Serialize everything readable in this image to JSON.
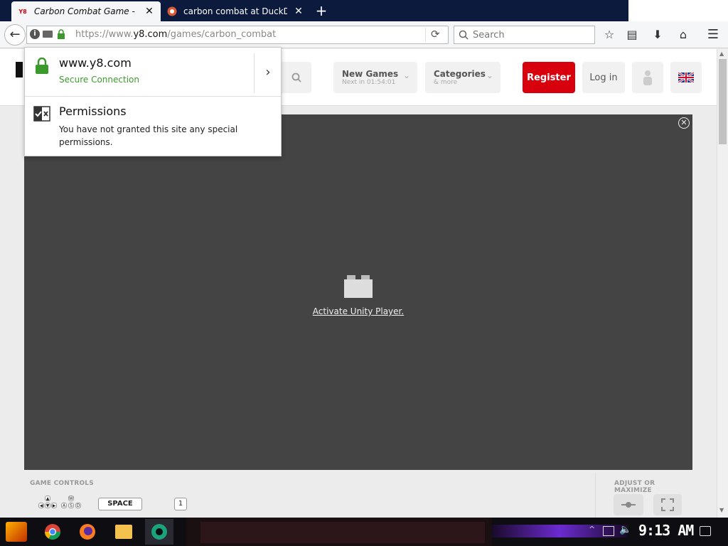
{
  "tabs": [
    {
      "title": "Carbon Combat Game - Play",
      "favicon": "y8-favicon",
      "active": true
    },
    {
      "title": "carbon combat at DuckDuc",
      "favicon": "duckduckgo-favicon",
      "active": false
    }
  ],
  "nav": {
    "url_prefix": "https://www.",
    "url_domain": "y8.com",
    "url_path": "/games/carbon_combat",
    "search_placeholder": "Search"
  },
  "site_header": {
    "new_games_label": "New Games",
    "new_games_sub": "Next in 01:54:01",
    "categories_label": "Categories",
    "categories_sub": "& more",
    "register_label": "Register",
    "login_label": "Log in"
  },
  "game": {
    "activate_label": "Activate Unity Player."
  },
  "controls": {
    "title": "GAME CONTROLS",
    "space_key": "SPACE",
    "one_key": "1",
    "adjust_title": "ADJUST OR MAXIMIZE"
  },
  "popup": {
    "domain": "www.y8.com",
    "connection": "Secure Connection",
    "permissions_title": "Permissions",
    "permissions_text": "You have not granted this site any special permissions."
  },
  "taskbar": {
    "clock": "9:13 AM"
  },
  "colors": {
    "accent_red": "#d9000d",
    "secure_green": "#3c9a2c",
    "game_bg": "#444444"
  }
}
